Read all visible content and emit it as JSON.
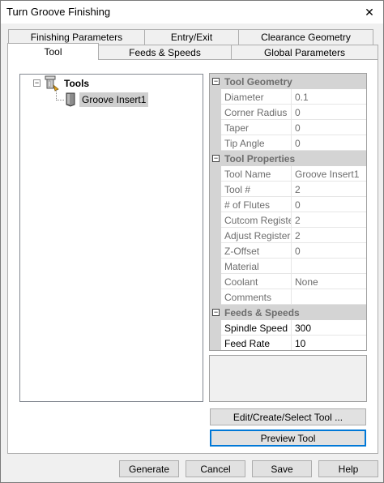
{
  "window": {
    "title": "Turn Groove Finishing",
    "close_glyph": "✕"
  },
  "tabs": {
    "row1": [
      "Finishing Parameters",
      "Entry/Exit",
      "Clearance Geometry"
    ],
    "row2": [
      "Tool",
      "Feeds & Speeds",
      "Global Parameters"
    ],
    "active": "Tool"
  },
  "tree": {
    "root": {
      "label": "Tools",
      "icon": "tool-holder-icon",
      "expander": "⊟"
    },
    "child": {
      "label": "Groove Insert1",
      "icon": "groove-insert-icon"
    }
  },
  "property_grid": {
    "categories": [
      {
        "label": "Tool Geometry",
        "toggle": "−",
        "rows": [
          {
            "name": "Diameter",
            "value": "0.1",
            "editable": false
          },
          {
            "name": "Corner Radius",
            "value": "0",
            "editable": false
          },
          {
            "name": "Taper",
            "value": "0",
            "editable": false
          },
          {
            "name": "Tip Angle",
            "value": "0",
            "editable": false
          }
        ]
      },
      {
        "label": "Tool Properties",
        "toggle": "−",
        "rows": [
          {
            "name": "Tool Name",
            "value": "Groove Insert1",
            "editable": false
          },
          {
            "name": "Tool #",
            "value": "2",
            "editable": false
          },
          {
            "name": "# of Flutes",
            "value": "0",
            "editable": false
          },
          {
            "name": "Cutcom Registe",
            "value": "2",
            "editable": false
          },
          {
            "name": "Adjust Register",
            "value": "2",
            "editable": false
          },
          {
            "name": "Z-Offset",
            "value": "0",
            "editable": false
          },
          {
            "name": "Material",
            "value": "",
            "editable": false
          },
          {
            "name": "Coolant",
            "value": "None",
            "editable": false
          },
          {
            "name": "Comments",
            "value": "",
            "editable": false
          }
        ]
      },
      {
        "label": "Feeds & Speeds",
        "toggle": "−",
        "rows": [
          {
            "name": "Spindle Speed",
            "value": "300",
            "editable": true
          },
          {
            "name": "Feed Rate",
            "value": "10",
            "editable": true
          }
        ]
      }
    ]
  },
  "buttons": {
    "edit_tool": "Edit/Create/Select Tool ...",
    "preview_tool": "Preview Tool",
    "generate": "Generate",
    "cancel": "Cancel",
    "save": "Save",
    "help": "Help"
  }
}
